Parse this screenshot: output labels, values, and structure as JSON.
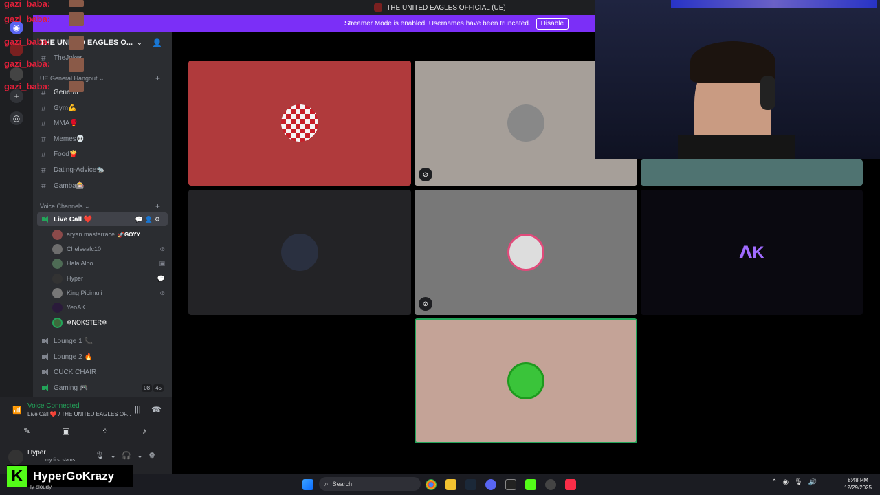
{
  "window": {
    "title": "THE UNITED EAGLES OFFICIAL (UE)"
  },
  "banner": {
    "text": "Streamer Mode is enabled. Usernames have been truncated.",
    "button": "Disable"
  },
  "server": {
    "name": "THE UNITED EAGLES O..."
  },
  "sidebar": {
    "top_channel": "TheJoker",
    "categories": {
      "text": "UE General Hangout",
      "voice": "Voice Channels"
    },
    "text_channels": [
      {
        "label": "General"
      },
      {
        "label": "Gym💪"
      },
      {
        "label": "MMA🥊"
      },
      {
        "label": "Memes💀"
      },
      {
        "label": "Food🍟"
      },
      {
        "label": "Dating-Advice🐀"
      },
      {
        "label": "Gamba🎰"
      }
    ],
    "live_call": {
      "label": "Live Call ❤️"
    },
    "members": [
      {
        "name": "aryan.masterrace",
        "tag": "🚀GOYY",
        "status": ""
      },
      {
        "name": "Chelseafc10",
        "tag": "",
        "status": "⊘"
      },
      {
        "name": "HalalAlbo",
        "tag": "",
        "status": "▣"
      },
      {
        "name": "Hyper",
        "tag": "",
        "status": "💬"
      },
      {
        "name": "King Picimuli",
        "tag": "",
        "status": "⊘"
      },
      {
        "name": "YeoAK",
        "tag": "",
        "status": ""
      },
      {
        "name": "❄NOKSTER❄",
        "tag": "",
        "status": ""
      }
    ],
    "voice_channels": [
      {
        "label": "Lounge 1 📞"
      },
      {
        "label": "Lounge 2 🔥"
      },
      {
        "label": "CUCK CHAIR"
      },
      {
        "label": "Gaming 🎮",
        "counts": [
          "08",
          "45"
        ]
      }
    ]
  },
  "voice_panel": {
    "status": "Voice Connected",
    "channel": "Live Call ❤️ / THE UNITED EAGLES OF..."
  },
  "user_panel": {
    "name": "Hyper",
    "status": "my first status"
  },
  "overlay": {
    "chat_name": "gazi_baba:",
    "brand": "HyperGoKrazy",
    "weather": "ly cloudy"
  },
  "taskbar": {
    "search": "Search",
    "time": "8:48 PM",
    "date": "12/29/2025"
  },
  "colors": {
    "accent": "#7b2ff7",
    "online": "#23a55a",
    "sidebar_bg": "#2b2d31",
    "rail_bg": "#1e1f22",
    "chat_red": "#e0203a",
    "kick_green": "#53fc18"
  }
}
